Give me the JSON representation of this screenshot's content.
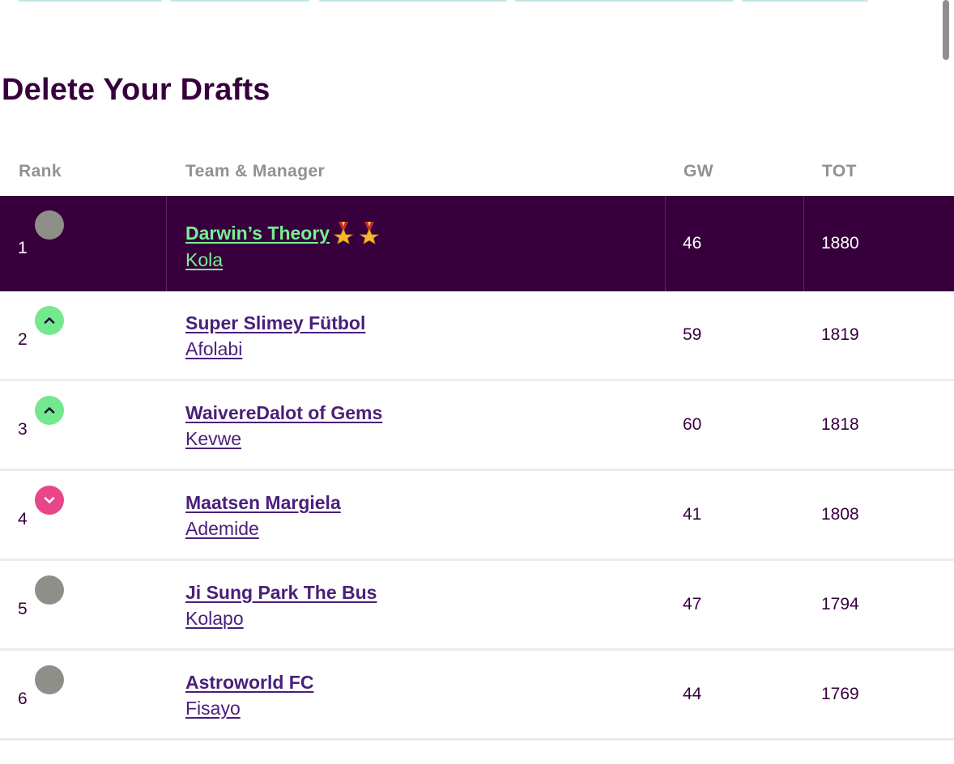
{
  "page": {
    "title": "Delete Your Drafts"
  },
  "table": {
    "headers": {
      "rank": "Rank",
      "team_manager": "Team & Manager",
      "gw": "GW",
      "tot": "TOT"
    },
    "rows": [
      {
        "rank": "1",
        "movement": "same",
        "team": "Darwin’s Theory",
        "manager": "Kola",
        "gw": "46",
        "tot": "1880",
        "highlight": true,
        "medals": 2
      },
      {
        "rank": "2",
        "movement": "up",
        "team": "Super Slimey Fütbol",
        "manager": "Afolabi",
        "gw": "59",
        "tot": "1819"
      },
      {
        "rank": "3",
        "movement": "up",
        "team": "WaivereDalot of Gems",
        "manager": "Kevwe",
        "gw": "60",
        "tot": "1818"
      },
      {
        "rank": "4",
        "movement": "down",
        "team": "Maatsen Margiela",
        "manager": "Ademide",
        "gw": "41",
        "tot": "1808"
      },
      {
        "rank": "5",
        "movement": "same",
        "team": "Ji Sung Park The Bus",
        "manager": "Kolapo",
        "gw": "47",
        "tot": "1794"
      },
      {
        "rank": "6",
        "movement": "same",
        "team": "Astroworld FC",
        "manager": "Fisayo",
        "gw": "44",
        "tot": "1769"
      }
    ]
  },
  "colors": {
    "primary": "#37003c",
    "accent_green": "#74e88e",
    "accent_pink": "#e94589",
    "neutral_grey": "#8f8f8a",
    "link_purple": "#4a1f7a"
  },
  "icons": {
    "up": "chevron-up-icon",
    "down": "chevron-down-icon",
    "same": "no-change-icon",
    "medal": "medal-icon"
  }
}
